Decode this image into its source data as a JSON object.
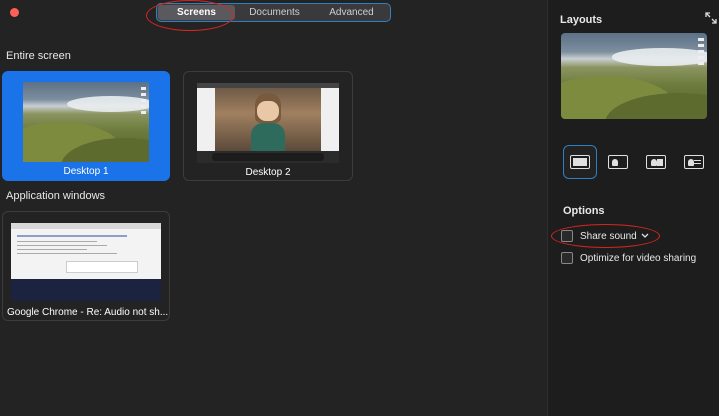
{
  "tabs": [
    {
      "label": "Screens"
    },
    {
      "label": "Documents"
    },
    {
      "label": "Advanced"
    }
  ],
  "sections": {
    "entire_screen": "Entire screen",
    "application_windows": "Application windows"
  },
  "screens": [
    {
      "caption": "Desktop 1",
      "selected": true
    },
    {
      "caption": "Desktop 2",
      "selected": false
    }
  ],
  "windows": [
    {
      "caption": "Google Chrome - Re: Audio not sh..."
    }
  ],
  "right_panel": {
    "layouts_title": "Layouts",
    "options_title": "Options",
    "options": [
      {
        "label": "Share sound",
        "checked": false
      },
      {
        "label": "Optimize for video sharing",
        "checked": false
      }
    ]
  },
  "colors": {
    "accent": "#1a73e8",
    "highlight_ring": "#d6261f",
    "close": "#ff5f57"
  }
}
